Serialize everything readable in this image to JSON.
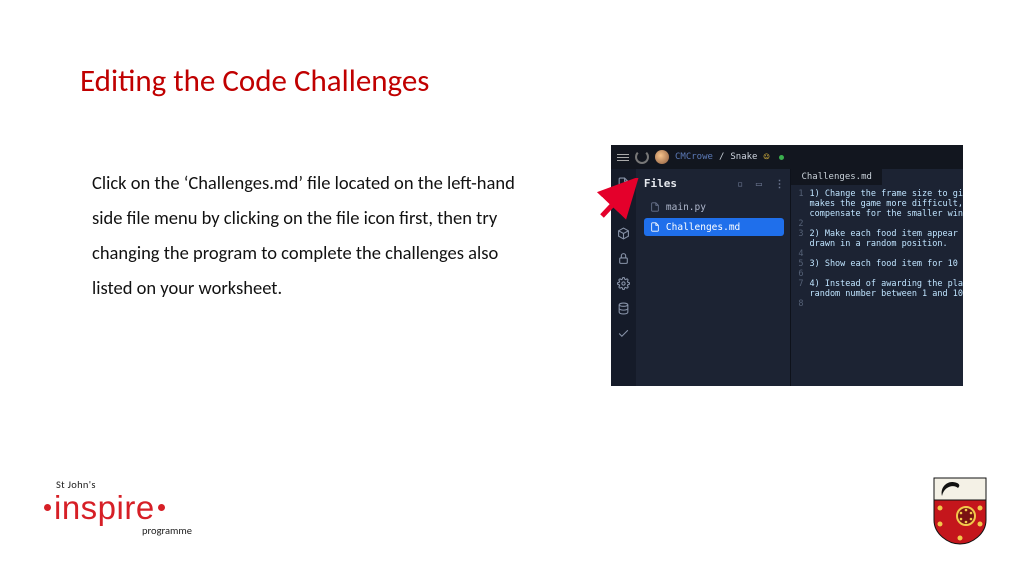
{
  "title": "Editing the Code Challenges",
  "body": "Click on the ‘Challenges.md’ file located on the left-hand side file menu by clicking on the file icon first, then try changing the program to complete the challenges also listed on your worksheet.",
  "ide": {
    "breadcrumb_user": "CMCrowe",
    "breadcrumb_sep": "/",
    "breadcrumb_project": "Snake",
    "files_header": "Files",
    "file_main": "main.py",
    "file_challenges": "Challenges.md",
    "editor_tab": "Challenges.md",
    "lines": {
      "l1": "1) Change the frame size to gi",
      "l2": "makes the game more difficult,",
      "l3": "compensate for the smaller win",
      "l4": "2) Make each food item appear",
      "l5": "drawn in a random position.",
      "l6": "3) Show each food item for 10",
      "l7": "4) Instead of awarding the pla",
      "l8": "random number between 1 and 10"
    },
    "ln": {
      "n1": "1",
      "n2": "2",
      "n3": "3",
      "n4": "4",
      "n5": "5",
      "n6": "6",
      "n7": "7",
      "n8": "8"
    }
  },
  "logo": {
    "top": "St John's",
    "word": "inspire",
    "bottom": "programme"
  }
}
